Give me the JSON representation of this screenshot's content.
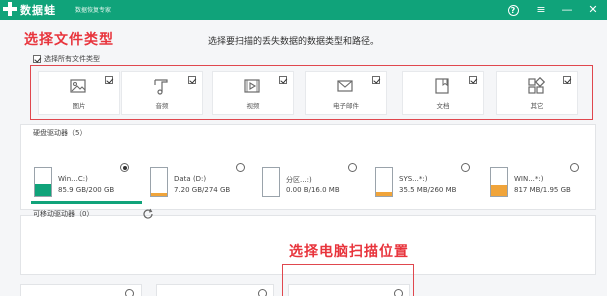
{
  "app": {
    "brand": "数据蛙",
    "subtitle": "数据恢复专家"
  },
  "title_bar": {
    "help_glyph": "?",
    "menu_glyph": "≡",
    "minimize_glyph": "—",
    "close_glyph": "✕"
  },
  "annotations": {
    "select_file_type": "选择文件类型",
    "select_location": "选择电脑扫描位置"
  },
  "instruction": "选择要扫描的丢失数据的数据类型和路径。",
  "select_all": {
    "label": "选择所有文件类型",
    "checked": true
  },
  "file_types": [
    {
      "label": "图片",
      "icon": "image-icon",
      "checked": true
    },
    {
      "label": "音频",
      "icon": "audio-icon",
      "checked": true
    },
    {
      "label": "视频",
      "icon": "video-icon",
      "checked": true
    },
    {
      "label": "电子邮件",
      "icon": "email-icon",
      "checked": true
    },
    {
      "label": "文档",
      "icon": "document-icon",
      "checked": true
    },
    {
      "label": "其它",
      "icon": "other-icon",
      "checked": true
    }
  ],
  "hard_drives": {
    "title": "硬盘驱动器（5）",
    "drives": [
      {
        "name": "Win...C:)",
        "size": "85.9 GB/200 GB",
        "used_fraction": 0.43,
        "selected": true
      },
      {
        "name": "Data (D:)",
        "size": "7.20 GB/274 GB",
        "used_fraction": 0.03,
        "selected": false
      },
      {
        "name": "分区...:)",
        "size": "0.00 B/16.0 MB",
        "used_fraction": 0.0,
        "selected": false
      },
      {
        "name": "SYS...*:)",
        "size": "35.5 MB/260 MB",
        "used_fraction": 0.14,
        "selected": false
      },
      {
        "name": "WIN...*:)",
        "size": "817 MB/1.95 GB",
        "used_fraction": 0.41,
        "selected": false
      }
    ]
  },
  "removable_drives": {
    "title": "可移动驱动器（0）"
  },
  "colors": {
    "accent": "#10a37a",
    "highlight": "#e8343c",
    "drive_fill_selected": "#10a37a",
    "drive_fill_default": "#f0a43a"
  }
}
